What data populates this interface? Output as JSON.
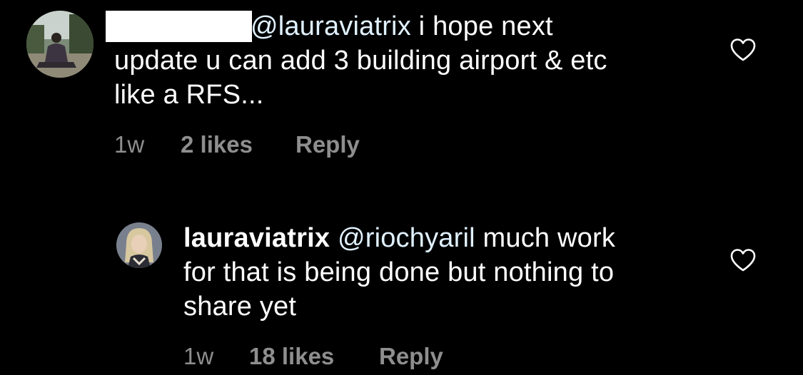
{
  "comments": [
    {
      "username": "",
      "mention": "@lauraviatrix",
      "text_line1": " i hope next",
      "text_line2": "update u can add 3 building airport & etc",
      "text_line3": "like a RFS...",
      "time": "1w",
      "likes": "2 likes",
      "reply_label": "Reply",
      "avatar_icon": "person-avatar-icon",
      "like_icon": "heart-outline-icon"
    },
    {
      "username": "lauraviatrix",
      "mention": "@riochyaril",
      "text_line1": " much work",
      "text_line2": "for that is being done but nothing to",
      "text_line3": "share yet",
      "time": "1w",
      "likes": "18 likes",
      "reply_label": "Reply",
      "avatar_icon": "person-avatar-icon",
      "like_icon": "heart-outline-icon"
    }
  ],
  "colors": {
    "background": "#000000",
    "text": "#ffffff",
    "meta": "#8e8e8e",
    "mention": "#e0f1ff",
    "redaction": "#ffffff"
  }
}
